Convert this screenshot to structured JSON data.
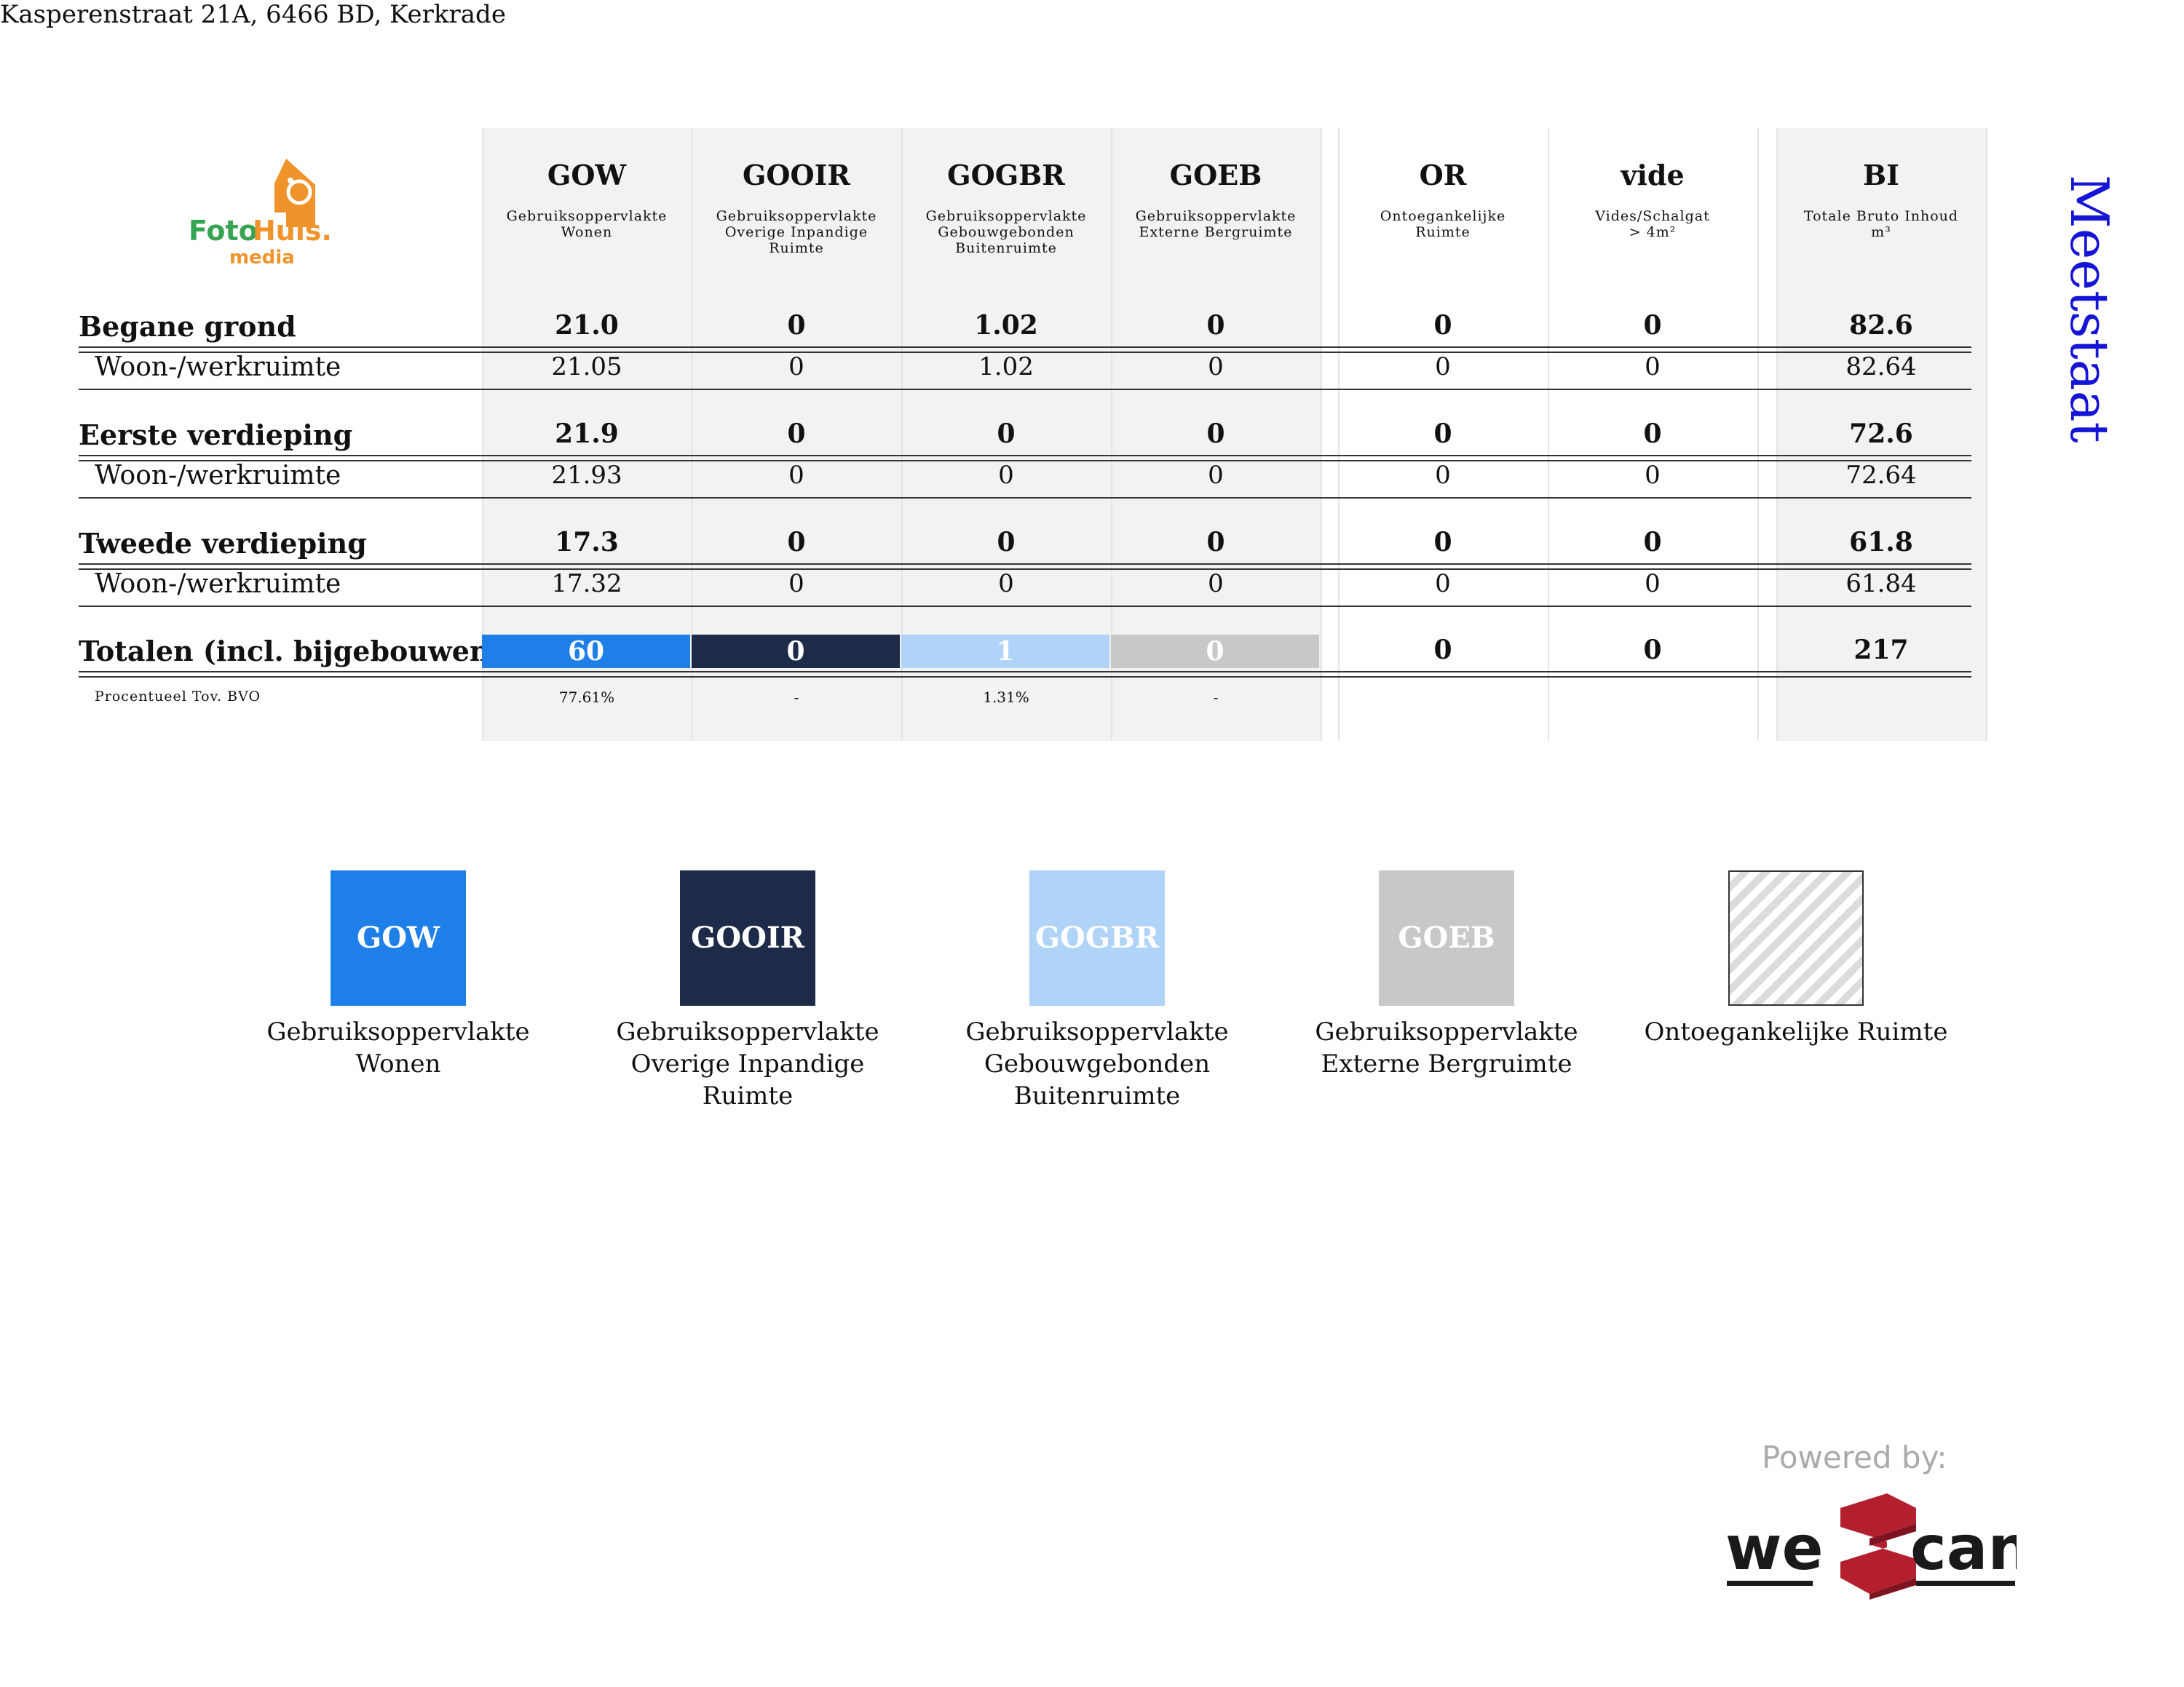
{
  "address": "Kasperenstraat 21A, 6466 BD, Kerkrade",
  "title": "Meetstaat",
  "logo": {
    "brand_a": "Foto",
    "brand_b": "Huis.",
    "sub": "media"
  },
  "columns": [
    {
      "code": "GOW",
      "desc": [
        "Gebruiksoppervlakte",
        "Wonen"
      ]
    },
    {
      "code": "GOOIR",
      "desc": [
        "Gebruiksoppervlakte",
        "Overige Inpandige",
        "Ruimte"
      ]
    },
    {
      "code": "GOGBR",
      "desc": [
        "Gebruiksoppervlakte",
        "Gebouwgebonden",
        "Buitenruimte"
      ]
    },
    {
      "code": "GOEB",
      "desc": [
        "Gebruiksoppervlakte",
        "Externe Bergruimte"
      ]
    },
    {
      "code": "OR",
      "desc": [
        "Ontoegankelijke",
        "Ruimte"
      ]
    },
    {
      "code": "vide",
      "desc": [
        "Vides/Schalgat",
        "> 4m²"
      ]
    },
    {
      "code": "BI",
      "desc": [
        "Totale Bruto Inhoud",
        "m³"
      ]
    }
  ],
  "floors": [
    {
      "name": "Begane grond",
      "totals": [
        "21.0",
        "0",
        "1.02",
        "0",
        "0",
        "0",
        "82.6"
      ],
      "rooms": [
        {
          "name": "Woon-/werkruimte",
          "values": [
            "21.05",
            "0",
            "1.02",
            "0",
            "0",
            "0",
            "82.64"
          ]
        }
      ]
    },
    {
      "name": "Eerste verdieping",
      "totals": [
        "21.9",
        "0",
        "0",
        "0",
        "0",
        "0",
        "72.6"
      ],
      "rooms": [
        {
          "name": "Woon-/werkruimte",
          "values": [
            "21.93",
            "0",
            "0",
            "0",
            "0",
            "0",
            "72.64"
          ]
        }
      ]
    },
    {
      "name": "Tweede verdieping",
      "totals": [
        "17.3",
        "0",
        "0",
        "0",
        "0",
        "0",
        "61.8"
      ],
      "rooms": [
        {
          "name": "Woon-/werkruimte",
          "values": [
            "17.32",
            "0",
            "0",
            "0",
            "0",
            "0",
            "61.84"
          ]
        }
      ]
    }
  ],
  "totals": {
    "label": "Totalen (incl. bijgebouwen)",
    "values": [
      "60",
      "0",
      "1",
      "0",
      "0",
      "0",
      "217"
    ]
  },
  "percent": {
    "label": "Procentueel Tov. BVO",
    "values": [
      "77.61%",
      "-",
      "1.31%",
      "-"
    ]
  },
  "colors": {
    "GOW": "#1e7fe8",
    "GOOIR": "#1d2b48",
    "GOGBR": "#b0d3f8",
    "GOEB": "#c8c8c8",
    "title": "#1515d6"
  },
  "legend": [
    {
      "code": "GOW",
      "label": [
        "Gebruiksoppervlakte",
        "Wonen"
      ]
    },
    {
      "code": "GOOIR",
      "label": [
        "Gebruiksoppervlakte",
        "Overige Inpandige Ruimte"
      ]
    },
    {
      "code": "GOGBR",
      "label": [
        "Gebruiksoppervlakte",
        "Gebouwgebonden",
        "Buitenruimte"
      ]
    },
    {
      "code": "GOEB",
      "label": [
        "Gebruiksoppervlakte",
        "Externe Bergruimte"
      ]
    },
    {
      "code": "",
      "label": [
        "Ontoegankelijke Ruimte"
      ]
    }
  ],
  "footer": {
    "powered": "Powered by:",
    "brand_left": "we",
    "brand_right": "can"
  }
}
